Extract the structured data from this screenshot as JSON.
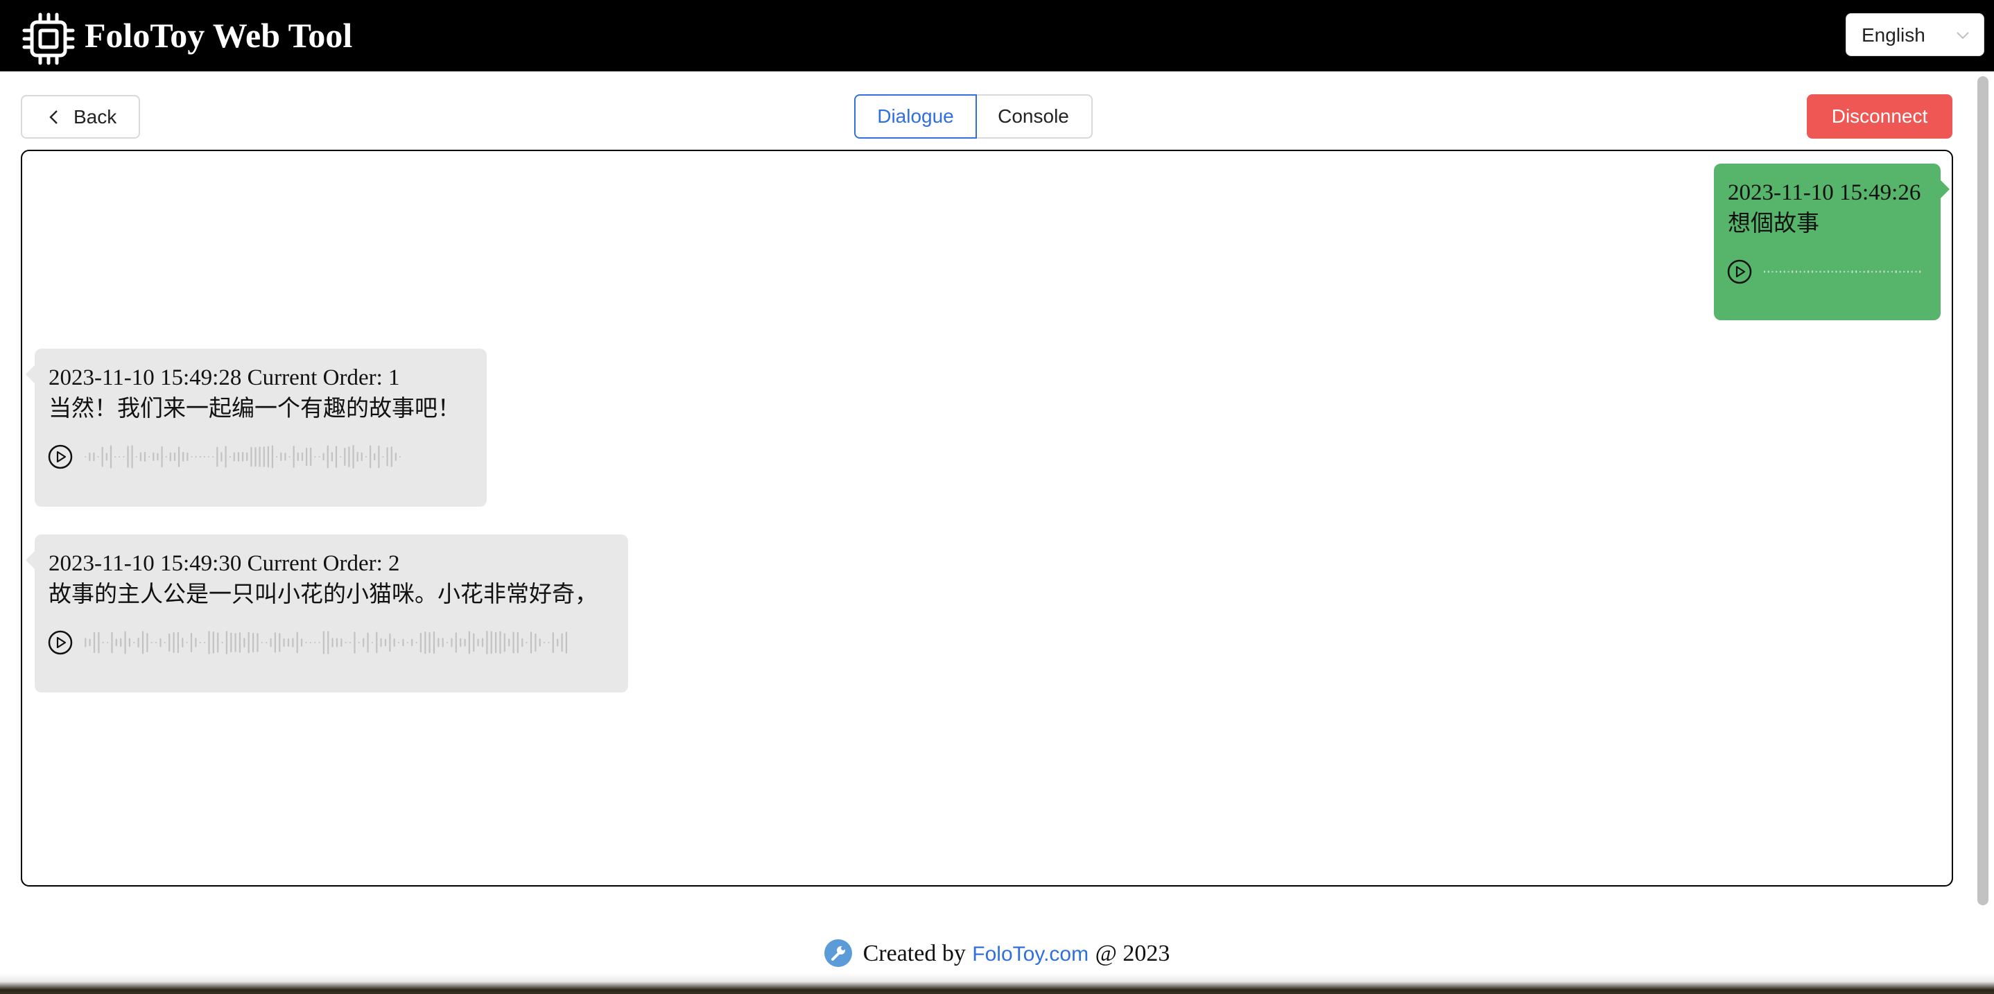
{
  "header": {
    "title": "FoloToy Web Tool",
    "logo_icon": "chip-icon",
    "language": {
      "selected": "English"
    }
  },
  "toolbar": {
    "back_label": "Back",
    "tabs": [
      {
        "label": "Dialogue",
        "active": true
      },
      {
        "label": "Console",
        "active": false
      }
    ],
    "disconnect_label": "Disconnect"
  },
  "messages": [
    {
      "role": "user",
      "meta": "2023-11-10 15:49:26",
      "text": "想個故事"
    },
    {
      "role": "bot",
      "meta": "2023-11-10 15:49:28 Current Order: 1",
      "text": "当然！我们来一起编一个有趣的故事吧！"
    },
    {
      "role": "bot",
      "meta": "2023-11-10 15:49:30 Current Order: 2",
      "text": "故事的主人公是一只叫小花的小猫咪。小花非常好奇，"
    }
  ],
  "footer": {
    "prefix": "Created by",
    "link": "FoloToy.com",
    "suffix": "@ 2023"
  },
  "colors": {
    "header_bg": "#000000",
    "accent": "#2f6fde",
    "danger": "#ee5753",
    "user_bubble": "#57b46b",
    "bot_bubble": "#e8e8e8"
  }
}
